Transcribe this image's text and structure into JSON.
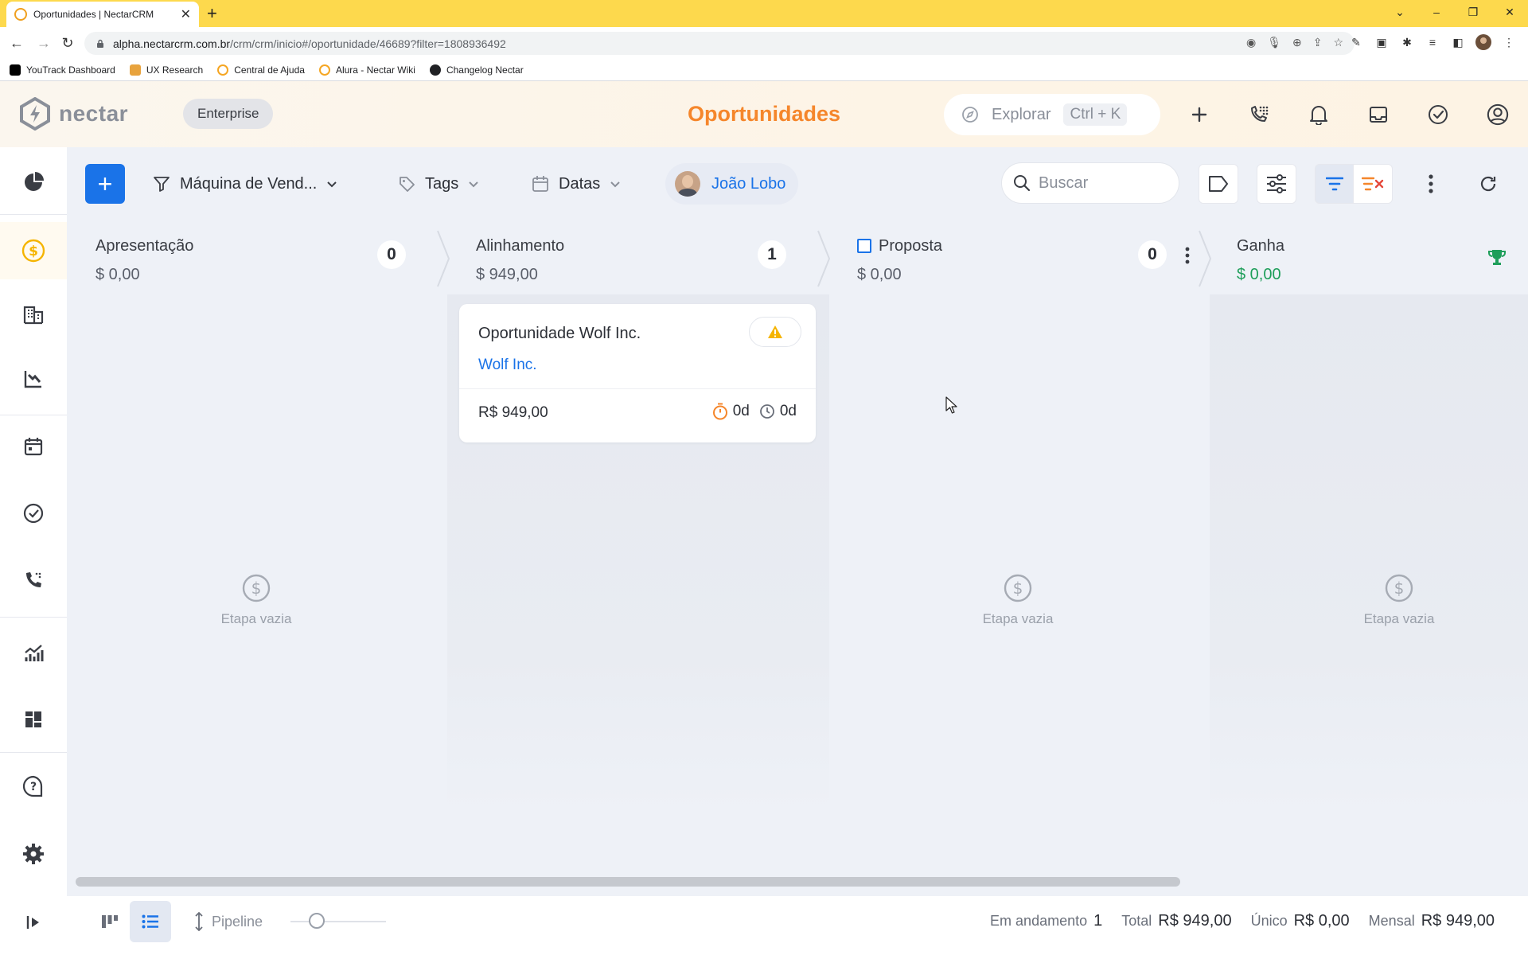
{
  "browser": {
    "tab_title": "Oportunidades | NectarCRM",
    "url_host": "alpha.nectarcrm.com.br",
    "url_path": "/crm/crm/inicio#/oportunidade/46689?filter=1808936492",
    "bookmarks": [
      {
        "label": "YouTrack Dashboard",
        "color": "#000000"
      },
      {
        "label": "UX Research",
        "color": "#e8a33d"
      },
      {
        "label": "Central de Ajuda",
        "color": "#f5a623"
      },
      {
        "label": "Alura - Nectar Wiki",
        "color": "#f5a623"
      },
      {
        "label": "Changelog Nectar",
        "color": "#202124"
      }
    ]
  },
  "header": {
    "logo_text": "nectar",
    "plan_badge": "Enterprise",
    "page_title": "Oportunidades",
    "explore_label": "Explorar",
    "explore_shortcut": "Ctrl + K"
  },
  "toolbar": {
    "pipeline_label": "Máquina de Vend...",
    "tags_label": "Tags",
    "dates_label": "Datas",
    "user_name": "João Lobo",
    "search_placeholder": "Buscar"
  },
  "stages": [
    {
      "name": "Apresentação",
      "value": "$ 0,00",
      "count": "0",
      "empty_label": "Etapa vazia"
    },
    {
      "name": "Alinhamento",
      "value": "$ 949,00",
      "count": "1"
    },
    {
      "name": "Proposta",
      "value": "$ 0,00",
      "count": "0",
      "empty_label": "Etapa vazia"
    },
    {
      "name": "Ganha",
      "value": "$ 0,00",
      "empty_label": "Etapa vazia"
    }
  ],
  "card": {
    "title": "Oportunidade Wolf Inc.",
    "company": "Wolf Inc.",
    "value": "R$ 949,00",
    "timer1": "0d",
    "timer2": "0d"
  },
  "footer": {
    "pipeline_label": "Pipeline",
    "in_progress_label": "Em andamento",
    "in_progress_value": "1",
    "total_label": "Total",
    "total_value": "R$ 949,00",
    "unique_label": "Único",
    "unique_value": "R$ 0,00",
    "monthly_label": "Mensal",
    "monthly_value": "R$ 949,00"
  },
  "colors": {
    "accent_orange": "#f5862b",
    "primary_blue": "#1a73e8",
    "won_green": "#1e9e5a",
    "warning_yellow": "#f5b400"
  }
}
